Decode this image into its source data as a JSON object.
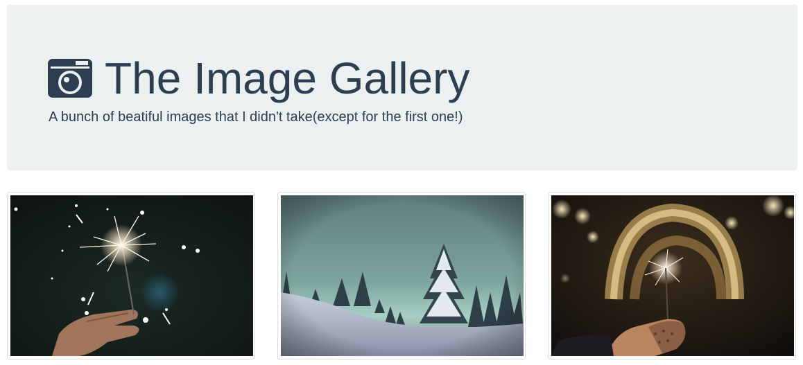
{
  "header": {
    "title": "The Image Gallery",
    "subtitle": "A bunch of beatiful images that I didn't take(except for the first one!)",
    "icon": "camera-icon"
  },
  "gallery": {
    "images": [
      {
        "subject": "sparkler held in hand at night"
      },
      {
        "subject": "snowy pine trees on a hillside"
      },
      {
        "subject": "sparkler in gloved hand with blurred arch of lights"
      }
    ]
  },
  "colors": {
    "jumbotron_bg": "#ecf0f1",
    "text": "#2c3e50",
    "thumbnail_border": "#dddddd"
  }
}
